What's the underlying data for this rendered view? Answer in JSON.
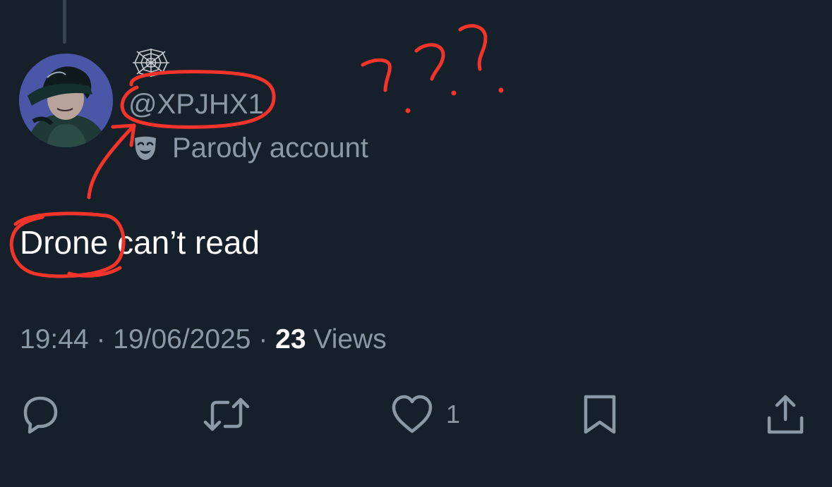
{
  "tweet": {
    "author": {
      "handle": "@XPJHX1",
      "avatar_icon": "avatar-icon",
      "profile_emoji_icon": "spider-web-icon",
      "parody_icon": "theater-mask-icon",
      "parody_label": "Parody account"
    },
    "text": {
      "highlighted_word": "Drone",
      "rest": " can’t read"
    },
    "meta": {
      "time": "19:44",
      "sep1": " · ",
      "date": "19/06/2025",
      "sep2": " · ",
      "views_count": "23",
      "views_label": " Views"
    },
    "actions": {
      "reply_icon": "reply-icon",
      "retweet_icon": "retweet-icon",
      "like_icon": "heart-icon",
      "like_count": "1",
      "bookmark_icon": "bookmark-icon",
      "share_icon": "share-icon"
    }
  },
  "colors": {
    "background": "#15202b",
    "text_primary": "#ffffff",
    "text_secondary": "#8b98a5",
    "annotation": "#f2342a"
  }
}
